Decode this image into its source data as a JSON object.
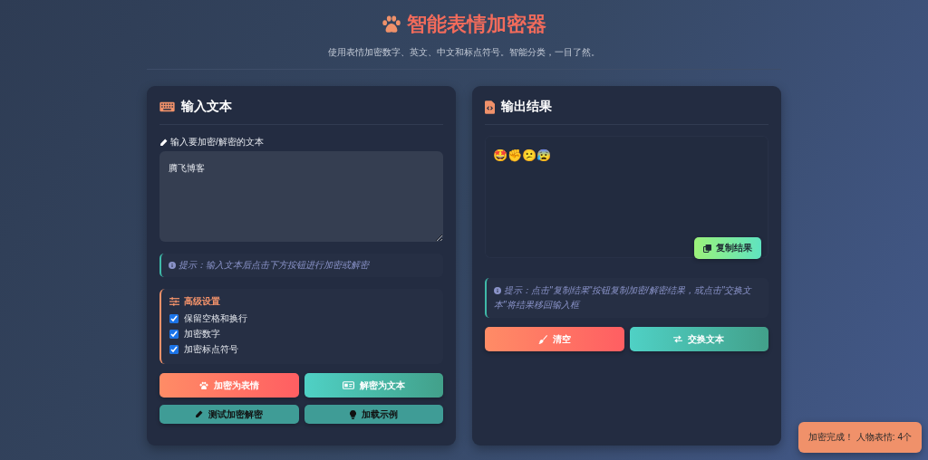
{
  "header": {
    "title": "智能表情加密器",
    "subtitle": "使用表情加密数字、英文、中文和标点符号。智能分类，一目了然。"
  },
  "input_panel": {
    "title": "输入文本",
    "field_label": "输入要加密/解密的文本",
    "value": "腾飞博客",
    "hint": "提示：输入文本后点击下方按钮进行加密或解密",
    "settings": {
      "title": "高级设置",
      "options": [
        {
          "label": "保留空格和换行",
          "checked": true
        },
        {
          "label": "加密数字",
          "checked": true
        },
        {
          "label": "加密标点符号",
          "checked": true
        }
      ]
    },
    "buttons": [
      {
        "label": "加密为表情",
        "kind": "warm"
      },
      {
        "label": "解密为文本",
        "kind": "teal"
      },
      {
        "label": "测试加密解密",
        "kind": "small"
      },
      {
        "label": "加载示例",
        "kind": "small"
      }
    ]
  },
  "output_panel": {
    "title": "输出结果",
    "value": "🤩✊😕😰",
    "copy_button": "复制结果",
    "hint": "提示：点击\"复制结果\"按钮复制加密/解密结果，或点击\"交换文本\"将结果移回输入框",
    "buttons": [
      {
        "label": "清空",
        "kind": "warm"
      },
      {
        "label": "交换文本",
        "kind": "teal"
      }
    ]
  },
  "toast": "加密完成！ 人物表情: 4个"
}
